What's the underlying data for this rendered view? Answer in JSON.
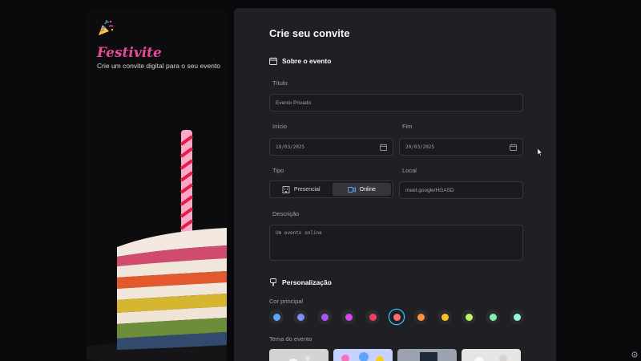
{
  "sidebar": {
    "brand": "Festivite",
    "tagline": "Crie um convite digital para o seu evento"
  },
  "form": {
    "heading": "Crie seu convite",
    "about_section": "Sobre o evento",
    "title_label": "Título",
    "title_value": "Evento Privado",
    "start_label": "Início",
    "start_value": "19/03/2025",
    "end_label": "Fim",
    "end_value": "20/03/2025",
    "type_label": "Tipo",
    "type_options": [
      "Presencial",
      "Online"
    ],
    "type_selected": "Online",
    "location_label": "Local",
    "location_value": "meet.google/HGASD",
    "description_label": "Descrição",
    "description_value": "Um evento online",
    "custom_section": "Personalização",
    "color_label": "Cor principal",
    "colors": [
      "#60a5fa",
      "#818cf8",
      "#a855f7",
      "#d946ef",
      "#f43f5e",
      "#f87171",
      "#fb923c",
      "#fbbf24",
      "#bef264",
      "#86efac",
      "#99f6e4"
    ],
    "selected_color": "#f87171",
    "theme_label": "Tema do evento"
  }
}
